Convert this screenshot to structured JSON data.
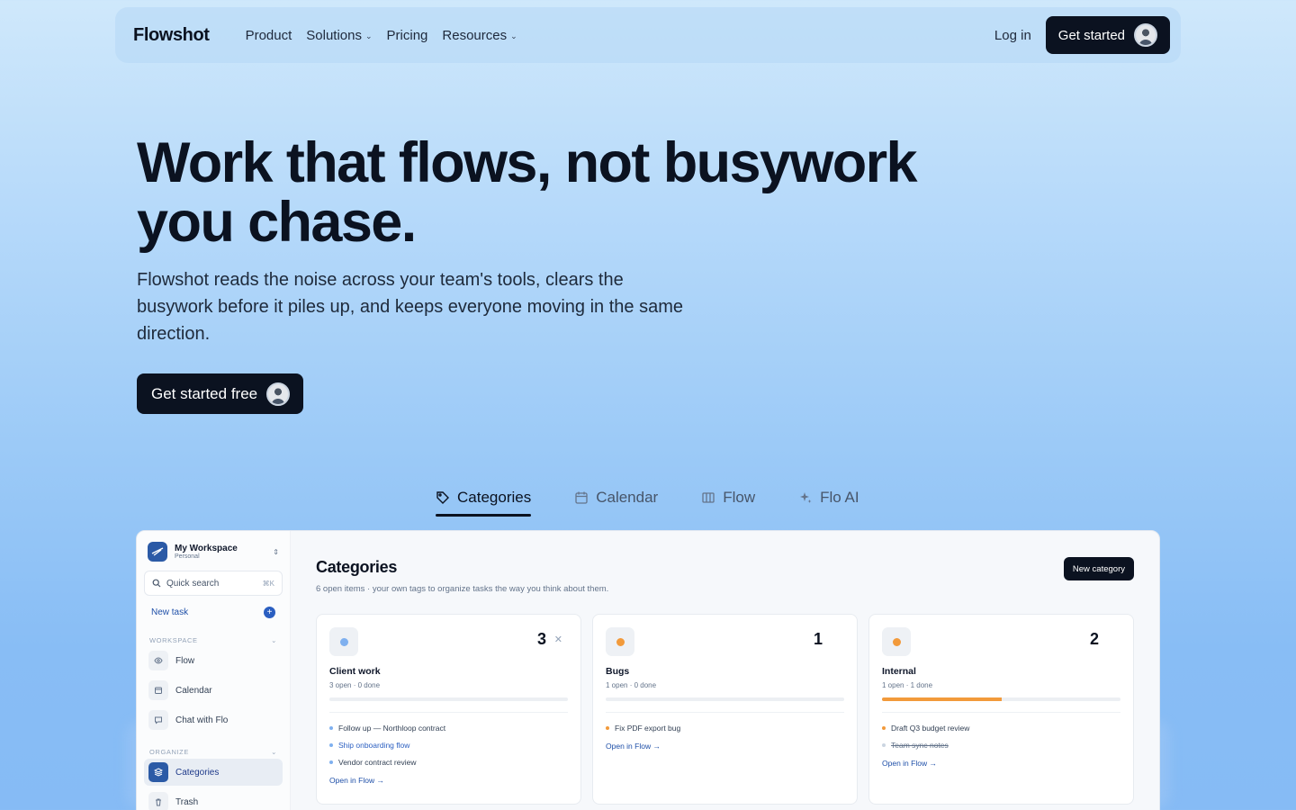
{
  "nav": {
    "logo": "Flowshot",
    "links": [
      {
        "label": "Product",
        "dropdown": false
      },
      {
        "label": "Solutions",
        "dropdown": true
      },
      {
        "label": "Pricing",
        "dropdown": false
      },
      {
        "label": "Resources",
        "dropdown": true
      }
    ],
    "login": "Log in",
    "cta": "Get started"
  },
  "hero": {
    "title": "Work that flows, not busywork you chase.",
    "subtitle": "Flowshot reads the noise across your team's tools, clears the busywork before it piles up, and keeps everyone moving in the same direction.",
    "cta": "Get started free"
  },
  "tabs": [
    {
      "label": "Categories",
      "icon": "tag-icon",
      "active": true
    },
    {
      "label": "Calendar",
      "icon": "calendar-icon",
      "active": false
    },
    {
      "label": "Flow",
      "icon": "columns-icon",
      "active": false
    },
    {
      "label": "Flo AI",
      "icon": "sparkle-icon",
      "active": false
    }
  ],
  "app": {
    "workspace": {
      "name": "My Workspace",
      "type": "Personal"
    },
    "search": {
      "placeholder": "Quick search",
      "shortcut": "⌘K"
    },
    "new_task": "New task",
    "sections": {
      "workspace": {
        "label": "WORKSPACE",
        "items": [
          {
            "label": "Flow",
            "icon": "eye-icon"
          },
          {
            "label": "Calendar",
            "icon": "calendar-icon"
          },
          {
            "label": "Chat with Flo",
            "icon": "chat-icon"
          }
        ]
      },
      "organize": {
        "label": "ORGANIZE",
        "items": [
          {
            "label": "Categories",
            "icon": "layers-icon",
            "active": true
          },
          {
            "label": "Trash",
            "icon": "trash-icon"
          }
        ]
      }
    },
    "main": {
      "title": "Categories",
      "subtitle": "6 open items · your own tags to organize tasks the way you think about them.",
      "new_button": "New category"
    },
    "cards": [
      {
        "name": "Client work",
        "count": "3",
        "stats": "3 open · 0 done",
        "progress": 0,
        "dot_color": "#7fb0ef",
        "tasks": [
          {
            "text": "Follow up — Northloop contract",
            "style": "normal"
          },
          {
            "text": "Ship onboarding flow",
            "style": "link"
          },
          {
            "text": "Vendor contract review",
            "style": "normal"
          }
        ],
        "open_link": "Open in Flow →"
      },
      {
        "name": "Bugs",
        "count": "1",
        "stats": "1 open · 0 done",
        "progress": 0,
        "dot_color": "#f29a3b",
        "tasks": [
          {
            "text": "Fix PDF export bug",
            "style": "normal"
          }
        ],
        "open_link": "Open in Flow →"
      },
      {
        "name": "Internal",
        "count": "2",
        "stats": "1 open · 1 done",
        "progress": 0.5,
        "dot_color": "#f29a3b",
        "tasks": [
          {
            "text": "Draft Q3 budget review",
            "style": "normal"
          },
          {
            "text": "Team sync notes",
            "style": "done"
          }
        ],
        "open_link": "Open in Flow →"
      }
    ]
  },
  "colors": {
    "accent": "#2b5fc1",
    "dark": "#0b1220",
    "orange": "#f29a3b"
  }
}
